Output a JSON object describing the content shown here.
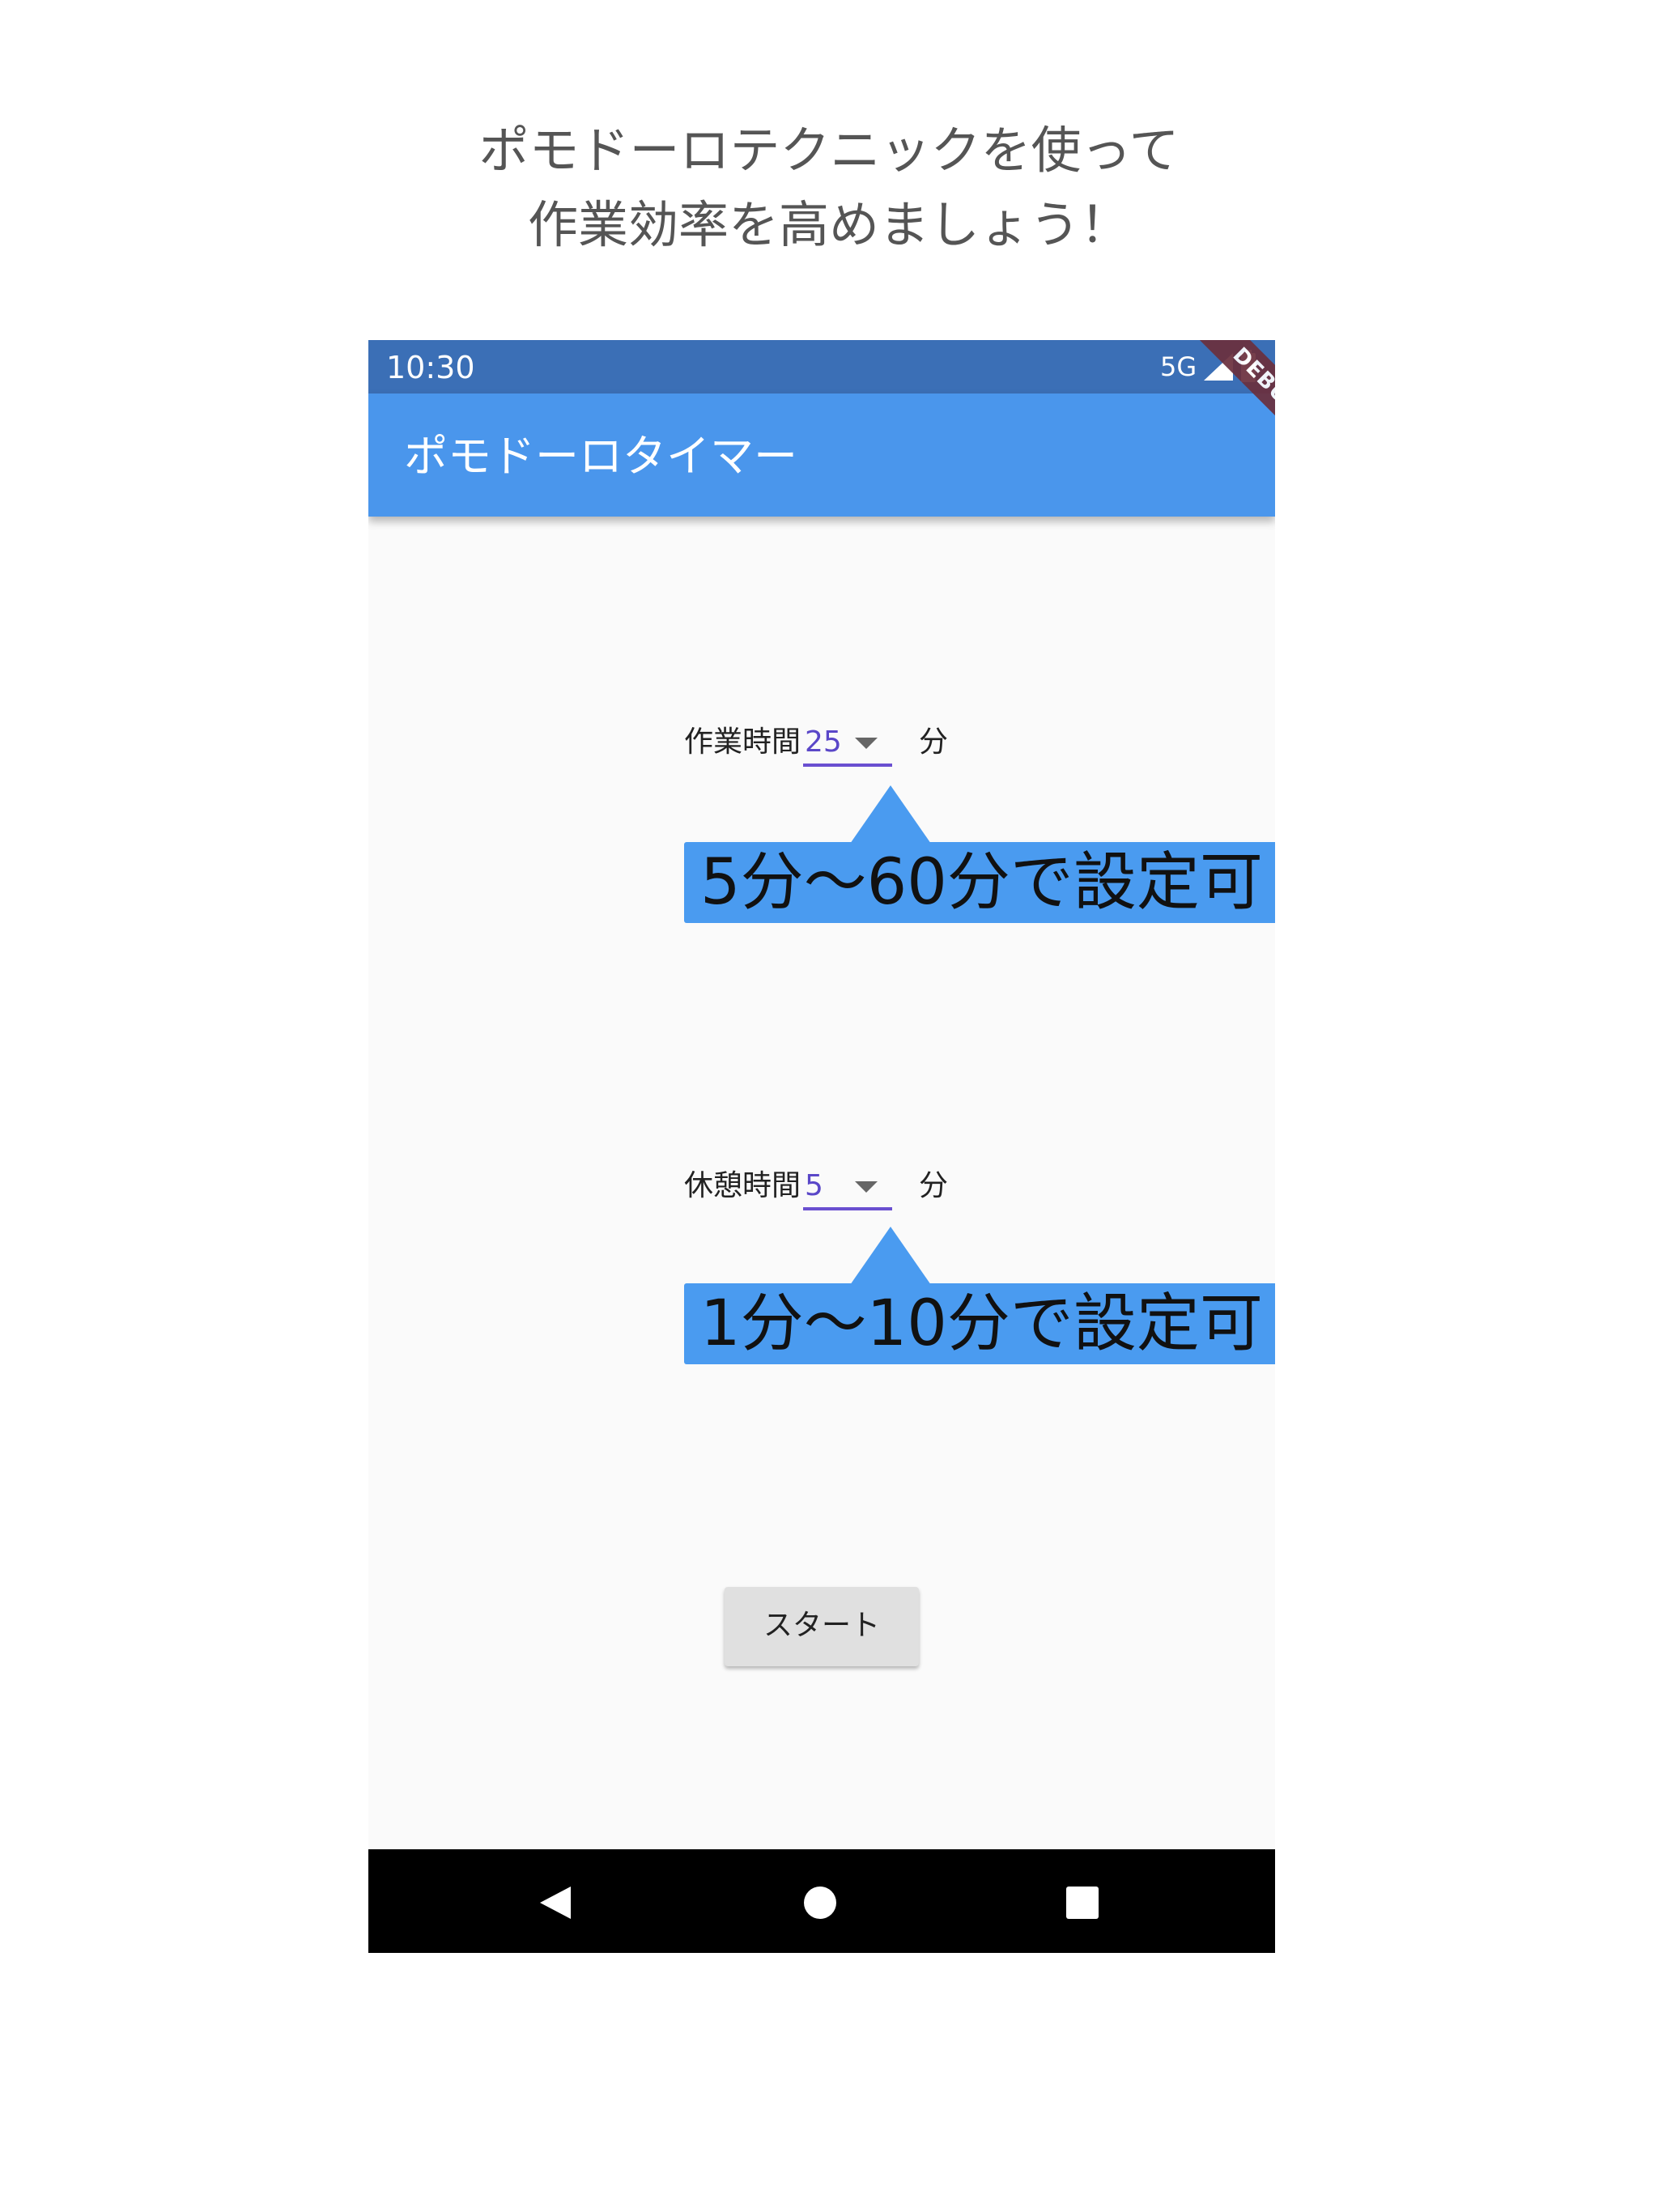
{
  "headline": {
    "line1": "ポモドーロテクニックを使って",
    "line2": "作業効率を高めましょう！"
  },
  "status_bar": {
    "time": "10:30",
    "network": "5G",
    "signal_icon": "signal-icon",
    "battery_icon": "battery-icon"
  },
  "app_bar": {
    "title": "ポモドーロタイマー"
  },
  "debug_banner": {
    "label": "DEBUG"
  },
  "work_setting": {
    "label": "作業時間",
    "value": "25",
    "unit": "分",
    "callout": "5分〜60分で設定可"
  },
  "break_setting": {
    "label": "休憩時間",
    "value": "5",
    "unit": "分",
    "callout": "1分〜10分で設定可"
  },
  "start_button": {
    "label": "スタート"
  },
  "nav_bar": {
    "back_icon": "back-triangle-icon",
    "home_icon": "home-circle-icon",
    "recents_icon": "recents-square-icon"
  },
  "colors": {
    "status_bar": "#3b6fb6",
    "app_bar": "#4a96ec",
    "accent": "#6a4fd0",
    "callout": "#4a9bf0",
    "debug_banner": "#6b2f3d"
  }
}
